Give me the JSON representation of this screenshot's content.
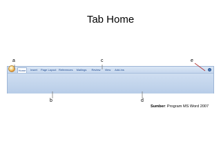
{
  "title": "Tab Home",
  "callouts": {
    "a": "a",
    "b": "b",
    "c": "c",
    "d": "d",
    "e": "e"
  },
  "ribbon": {
    "tabs": [
      {
        "label": "Home",
        "active": true
      },
      {
        "label": "Insert",
        "active": false
      },
      {
        "label": "Page Layout",
        "active": false
      },
      {
        "label": "References",
        "active": false
      },
      {
        "label": "Mailings",
        "active": false
      },
      {
        "label": "Review",
        "active": false
      },
      {
        "label": "View",
        "active": false
      },
      {
        "label": "Add-Ins",
        "active": false
      }
    ],
    "office_button_icon": "office-logo-icon",
    "help_button_icon": "help-icon"
  },
  "source": {
    "label": "Sumber",
    "text": ": Program MS Word 2007"
  },
  "colors": {
    "ribbon_bg": "#bdd0e8",
    "tab_text": "#15428b",
    "leader": "#7a7a7a"
  }
}
